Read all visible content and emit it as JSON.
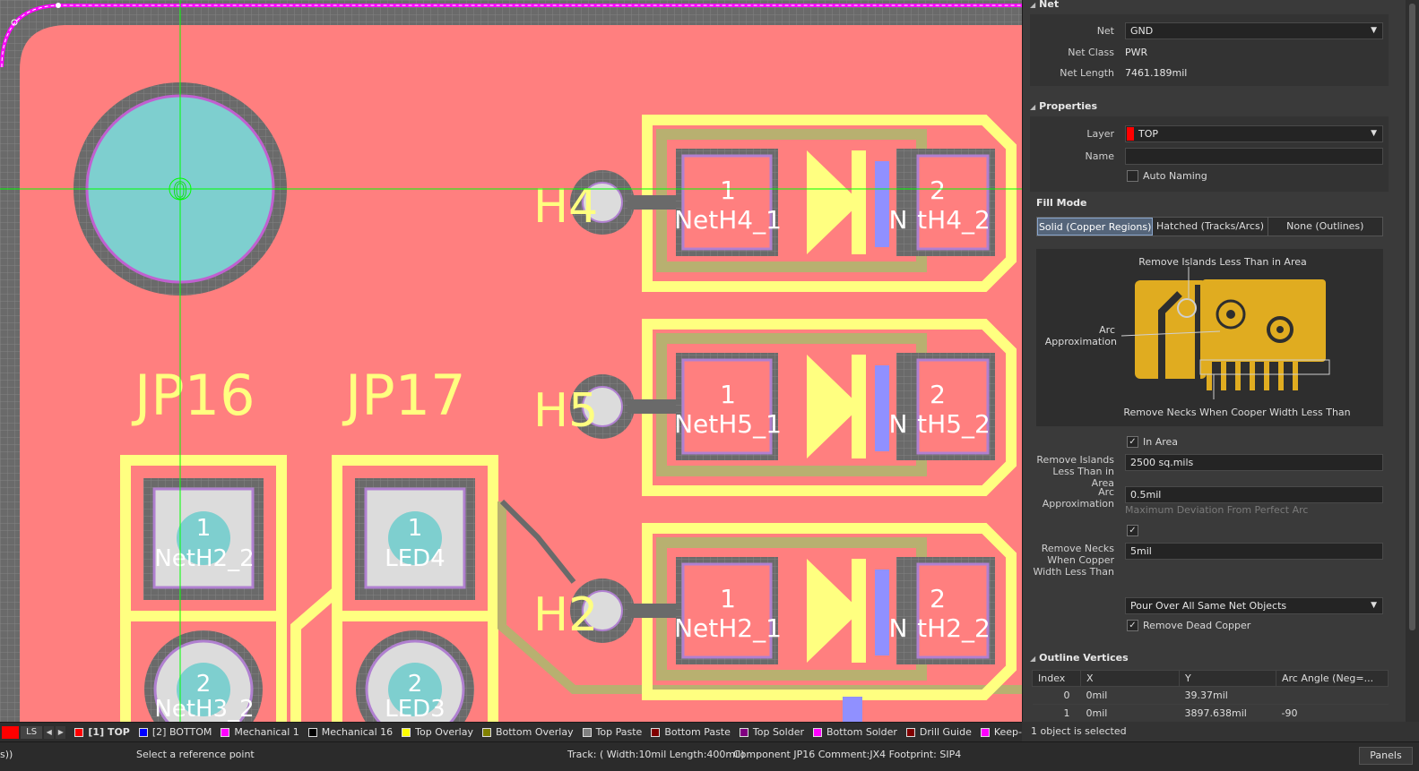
{
  "canvas": {
    "designators": [
      "JP16",
      "JP17"
    ],
    "center_marker": "0",
    "pads_left": [
      {
        "num": "1",
        "net": "NetH2_2"
      },
      {
        "num": "1",
        "net": "LED4"
      },
      {
        "num": "2",
        "net": "NetH3_2"
      },
      {
        "num": "2",
        "net": "LED3"
      }
    ],
    "led_rows": [
      {
        "ref": "H4",
        "pad1_num": "1",
        "pad1_net": "NetH4_1",
        "pad2_num": "2",
        "pad2_net": "tH4_2",
        "letter": "N"
      },
      {
        "ref": "H5",
        "pad1_num": "1",
        "pad1_net": "NetH5_1",
        "pad2_num": "2",
        "pad2_net": "tH5_2",
        "letter": "N"
      },
      {
        "ref": "H2",
        "pad1_num": "1",
        "pad1_net": "NetH2_1",
        "pad2_num": "2",
        "pad2_net": "tH2_2",
        "letter": "N"
      }
    ],
    "colors": {
      "copper": "#ff7f7f",
      "overlay": "#ffff80",
      "bottom_overlay": "#b8b070",
      "pad": "#dcdcdc",
      "via": "#7ecfcf",
      "grid": "#6a6a6a"
    }
  },
  "panel": {
    "net_section": {
      "title": "Net",
      "net_label": "Net",
      "net_value": "GND",
      "class_label": "Net Class",
      "class_value": "PWR",
      "length_label": "Net Length",
      "length_value": "7461.189mil"
    },
    "properties": {
      "title": "Properties",
      "layer_label": "Layer",
      "layer_value": "TOP",
      "name_label": "Name",
      "name_value": "",
      "auto_naming": "Auto Naming"
    },
    "fill_mode": {
      "title": "Fill Mode",
      "tabs": [
        "Solid (Copper Regions)",
        "Hatched (Tracks/Arcs)",
        "None (Outlines)"
      ],
      "diagram": {
        "islands": "Remove Islands Less Than in Area",
        "arc1": "Arc",
        "arc2": "Approximation",
        "necks": "Remove Necks When Cooper Width Less Than"
      },
      "in_area": "In Area",
      "islands_label1": "Remove Islands",
      "islands_label2": "Less Than in Area",
      "islands_value": "2500 sq.mils",
      "arc_label1": "Arc",
      "arc_label2": "Approximation",
      "arc_value": "0.5mil",
      "arc_hint": "Maximum Deviation From Perfect Arc",
      "necks_label1": "Remove Necks",
      "necks_label2": "When Copper",
      "necks_label3": "Width Less Than",
      "necks_value": "5mil",
      "pour_value": "Pour Over All Same Net Objects",
      "dead_copper": "Remove Dead Copper"
    },
    "outline": {
      "title": "Outline Vertices",
      "headers": [
        "Index",
        "X",
        "Y",
        "Arc Angle (Neg=..."
      ],
      "rows": [
        {
          "index": "0",
          "x": "0mil",
          "y": "39.37mil",
          "arc": ""
        },
        {
          "index": "1",
          "x": "0mil",
          "y": "3897.638mil",
          "arc": "-90"
        }
      ]
    },
    "selection": "1 object is selected"
  },
  "layerbar": {
    "ls": "LS",
    "layers": [
      {
        "name": "[1] TOP",
        "color": "#ff0000"
      },
      {
        "name": "[2] BOTTOM",
        "color": "#0000ff"
      },
      {
        "name": "Mechanical 1",
        "color": "#ff00ff"
      },
      {
        "name": "Mechanical 16",
        "color": "#000000"
      },
      {
        "name": "Top Overlay",
        "color": "#ffff00"
      },
      {
        "name": "Bottom Overlay",
        "color": "#808000"
      },
      {
        "name": "Top Paste",
        "color": "#808080"
      },
      {
        "name": "Bottom Paste",
        "color": "#800000"
      },
      {
        "name": "Top Solder",
        "color": "#800080"
      },
      {
        "name": "Bottom Solder",
        "color": "#ff00ff"
      },
      {
        "name": "Drill Guide",
        "color": "#800000"
      },
      {
        "name": "Keep-",
        "color": "#ff00ff"
      }
    ]
  },
  "status": {
    "left": "s))",
    "prompt": "Select a reference point",
    "track": "Track: ( Width:10mil Length:400mil)",
    "component": "Component JP16 Comment:JX4 Footprint: SIP4",
    "panels": "Panels"
  }
}
